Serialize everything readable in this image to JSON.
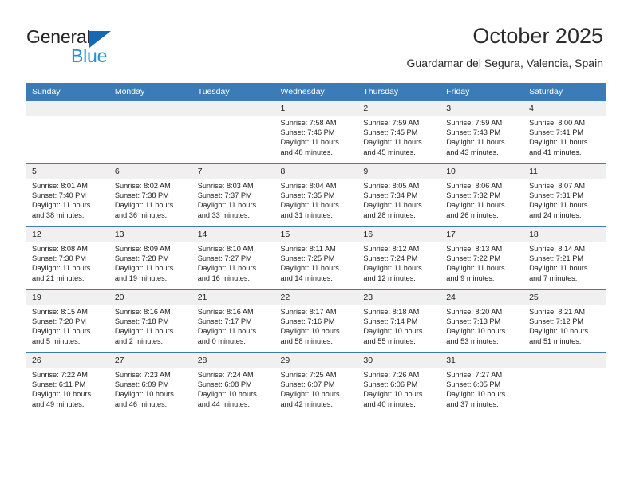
{
  "brand": {
    "name_part1": "General",
    "name_part2": "Blue",
    "triangle_icon": "triangle-logo-icon",
    "accent_dark": "#1668b3",
    "accent_light": "#2a8fd4"
  },
  "header": {
    "title": "October 2025",
    "subtitle": "Guardamar del Segura, Valencia, Spain"
  },
  "theme": {
    "header_row_bg": "#3b7cb8",
    "header_row_text": "#ffffff",
    "daynum_bg": "#f0f0f0",
    "grid_line": "#3b7cb8",
    "body_text": "#222222"
  },
  "weekdays": [
    "Sunday",
    "Monday",
    "Tuesday",
    "Wednesday",
    "Thursday",
    "Friday",
    "Saturday"
  ],
  "calendar": {
    "month": "October",
    "year": "2025",
    "weeks": [
      [
        {
          "day": "",
          "empty": true,
          "sunrise": "",
          "sunset": "",
          "daylight_line1": "",
          "daylight_line2": ""
        },
        {
          "day": "",
          "empty": true,
          "sunrise": "",
          "sunset": "",
          "daylight_line1": "",
          "daylight_line2": ""
        },
        {
          "day": "",
          "empty": true,
          "sunrise": "",
          "sunset": "",
          "daylight_line1": "",
          "daylight_line2": ""
        },
        {
          "day": "1",
          "empty": false,
          "sunrise": "Sunrise: 7:58 AM",
          "sunset": "Sunset: 7:46 PM",
          "daylight_line1": "Daylight: 11 hours",
          "daylight_line2": "and 48 minutes."
        },
        {
          "day": "2",
          "empty": false,
          "sunrise": "Sunrise: 7:59 AM",
          "sunset": "Sunset: 7:45 PM",
          "daylight_line1": "Daylight: 11 hours",
          "daylight_line2": "and 45 minutes."
        },
        {
          "day": "3",
          "empty": false,
          "sunrise": "Sunrise: 7:59 AM",
          "sunset": "Sunset: 7:43 PM",
          "daylight_line1": "Daylight: 11 hours",
          "daylight_line2": "and 43 minutes."
        },
        {
          "day": "4",
          "empty": false,
          "sunrise": "Sunrise: 8:00 AM",
          "sunset": "Sunset: 7:41 PM",
          "daylight_line1": "Daylight: 11 hours",
          "daylight_line2": "and 41 minutes."
        }
      ],
      [
        {
          "day": "5",
          "empty": false,
          "sunrise": "Sunrise: 8:01 AM",
          "sunset": "Sunset: 7:40 PM",
          "daylight_line1": "Daylight: 11 hours",
          "daylight_line2": "and 38 minutes."
        },
        {
          "day": "6",
          "empty": false,
          "sunrise": "Sunrise: 8:02 AM",
          "sunset": "Sunset: 7:38 PM",
          "daylight_line1": "Daylight: 11 hours",
          "daylight_line2": "and 36 minutes."
        },
        {
          "day": "7",
          "empty": false,
          "sunrise": "Sunrise: 8:03 AM",
          "sunset": "Sunset: 7:37 PM",
          "daylight_line1": "Daylight: 11 hours",
          "daylight_line2": "and 33 minutes."
        },
        {
          "day": "8",
          "empty": false,
          "sunrise": "Sunrise: 8:04 AM",
          "sunset": "Sunset: 7:35 PM",
          "daylight_line1": "Daylight: 11 hours",
          "daylight_line2": "and 31 minutes."
        },
        {
          "day": "9",
          "empty": false,
          "sunrise": "Sunrise: 8:05 AM",
          "sunset": "Sunset: 7:34 PM",
          "daylight_line1": "Daylight: 11 hours",
          "daylight_line2": "and 28 minutes."
        },
        {
          "day": "10",
          "empty": false,
          "sunrise": "Sunrise: 8:06 AM",
          "sunset": "Sunset: 7:32 PM",
          "daylight_line1": "Daylight: 11 hours",
          "daylight_line2": "and 26 minutes."
        },
        {
          "day": "11",
          "empty": false,
          "sunrise": "Sunrise: 8:07 AM",
          "sunset": "Sunset: 7:31 PM",
          "daylight_line1": "Daylight: 11 hours",
          "daylight_line2": "and 24 minutes."
        }
      ],
      [
        {
          "day": "12",
          "empty": false,
          "sunrise": "Sunrise: 8:08 AM",
          "sunset": "Sunset: 7:30 PM",
          "daylight_line1": "Daylight: 11 hours",
          "daylight_line2": "and 21 minutes."
        },
        {
          "day": "13",
          "empty": false,
          "sunrise": "Sunrise: 8:09 AM",
          "sunset": "Sunset: 7:28 PM",
          "daylight_line1": "Daylight: 11 hours",
          "daylight_line2": "and 19 minutes."
        },
        {
          "day": "14",
          "empty": false,
          "sunrise": "Sunrise: 8:10 AM",
          "sunset": "Sunset: 7:27 PM",
          "daylight_line1": "Daylight: 11 hours",
          "daylight_line2": "and 16 minutes."
        },
        {
          "day": "15",
          "empty": false,
          "sunrise": "Sunrise: 8:11 AM",
          "sunset": "Sunset: 7:25 PM",
          "daylight_line1": "Daylight: 11 hours",
          "daylight_line2": "and 14 minutes."
        },
        {
          "day": "16",
          "empty": false,
          "sunrise": "Sunrise: 8:12 AM",
          "sunset": "Sunset: 7:24 PM",
          "daylight_line1": "Daylight: 11 hours",
          "daylight_line2": "and 12 minutes."
        },
        {
          "day": "17",
          "empty": false,
          "sunrise": "Sunrise: 8:13 AM",
          "sunset": "Sunset: 7:22 PM",
          "daylight_line1": "Daylight: 11 hours",
          "daylight_line2": "and 9 minutes."
        },
        {
          "day": "18",
          "empty": false,
          "sunrise": "Sunrise: 8:14 AM",
          "sunset": "Sunset: 7:21 PM",
          "daylight_line1": "Daylight: 11 hours",
          "daylight_line2": "and 7 minutes."
        }
      ],
      [
        {
          "day": "19",
          "empty": false,
          "sunrise": "Sunrise: 8:15 AM",
          "sunset": "Sunset: 7:20 PM",
          "daylight_line1": "Daylight: 11 hours",
          "daylight_line2": "and 5 minutes."
        },
        {
          "day": "20",
          "empty": false,
          "sunrise": "Sunrise: 8:16 AM",
          "sunset": "Sunset: 7:18 PM",
          "daylight_line1": "Daylight: 11 hours",
          "daylight_line2": "and 2 minutes."
        },
        {
          "day": "21",
          "empty": false,
          "sunrise": "Sunrise: 8:16 AM",
          "sunset": "Sunset: 7:17 PM",
          "daylight_line1": "Daylight: 11 hours",
          "daylight_line2": "and 0 minutes."
        },
        {
          "day": "22",
          "empty": false,
          "sunrise": "Sunrise: 8:17 AM",
          "sunset": "Sunset: 7:16 PM",
          "daylight_line1": "Daylight: 10 hours",
          "daylight_line2": "and 58 minutes."
        },
        {
          "day": "23",
          "empty": false,
          "sunrise": "Sunrise: 8:18 AM",
          "sunset": "Sunset: 7:14 PM",
          "daylight_line1": "Daylight: 10 hours",
          "daylight_line2": "and 55 minutes."
        },
        {
          "day": "24",
          "empty": false,
          "sunrise": "Sunrise: 8:20 AM",
          "sunset": "Sunset: 7:13 PM",
          "daylight_line1": "Daylight: 10 hours",
          "daylight_line2": "and 53 minutes."
        },
        {
          "day": "25",
          "empty": false,
          "sunrise": "Sunrise: 8:21 AM",
          "sunset": "Sunset: 7:12 PM",
          "daylight_line1": "Daylight: 10 hours",
          "daylight_line2": "and 51 minutes."
        }
      ],
      [
        {
          "day": "26",
          "empty": false,
          "sunrise": "Sunrise: 7:22 AM",
          "sunset": "Sunset: 6:11 PM",
          "daylight_line1": "Daylight: 10 hours",
          "daylight_line2": "and 49 minutes."
        },
        {
          "day": "27",
          "empty": false,
          "sunrise": "Sunrise: 7:23 AM",
          "sunset": "Sunset: 6:09 PM",
          "daylight_line1": "Daylight: 10 hours",
          "daylight_line2": "and 46 minutes."
        },
        {
          "day": "28",
          "empty": false,
          "sunrise": "Sunrise: 7:24 AM",
          "sunset": "Sunset: 6:08 PM",
          "daylight_line1": "Daylight: 10 hours",
          "daylight_line2": "and 44 minutes."
        },
        {
          "day": "29",
          "empty": false,
          "sunrise": "Sunrise: 7:25 AM",
          "sunset": "Sunset: 6:07 PM",
          "daylight_line1": "Daylight: 10 hours",
          "daylight_line2": "and 42 minutes."
        },
        {
          "day": "30",
          "empty": false,
          "sunrise": "Sunrise: 7:26 AM",
          "sunset": "Sunset: 6:06 PM",
          "daylight_line1": "Daylight: 10 hours",
          "daylight_line2": "and 40 minutes."
        },
        {
          "day": "31",
          "empty": false,
          "sunrise": "Sunrise: 7:27 AM",
          "sunset": "Sunset: 6:05 PM",
          "daylight_line1": "Daylight: 10 hours",
          "daylight_line2": "and 37 minutes."
        },
        {
          "day": "",
          "empty": true,
          "sunrise": "",
          "sunset": "",
          "daylight_line1": "",
          "daylight_line2": ""
        }
      ]
    ]
  }
}
